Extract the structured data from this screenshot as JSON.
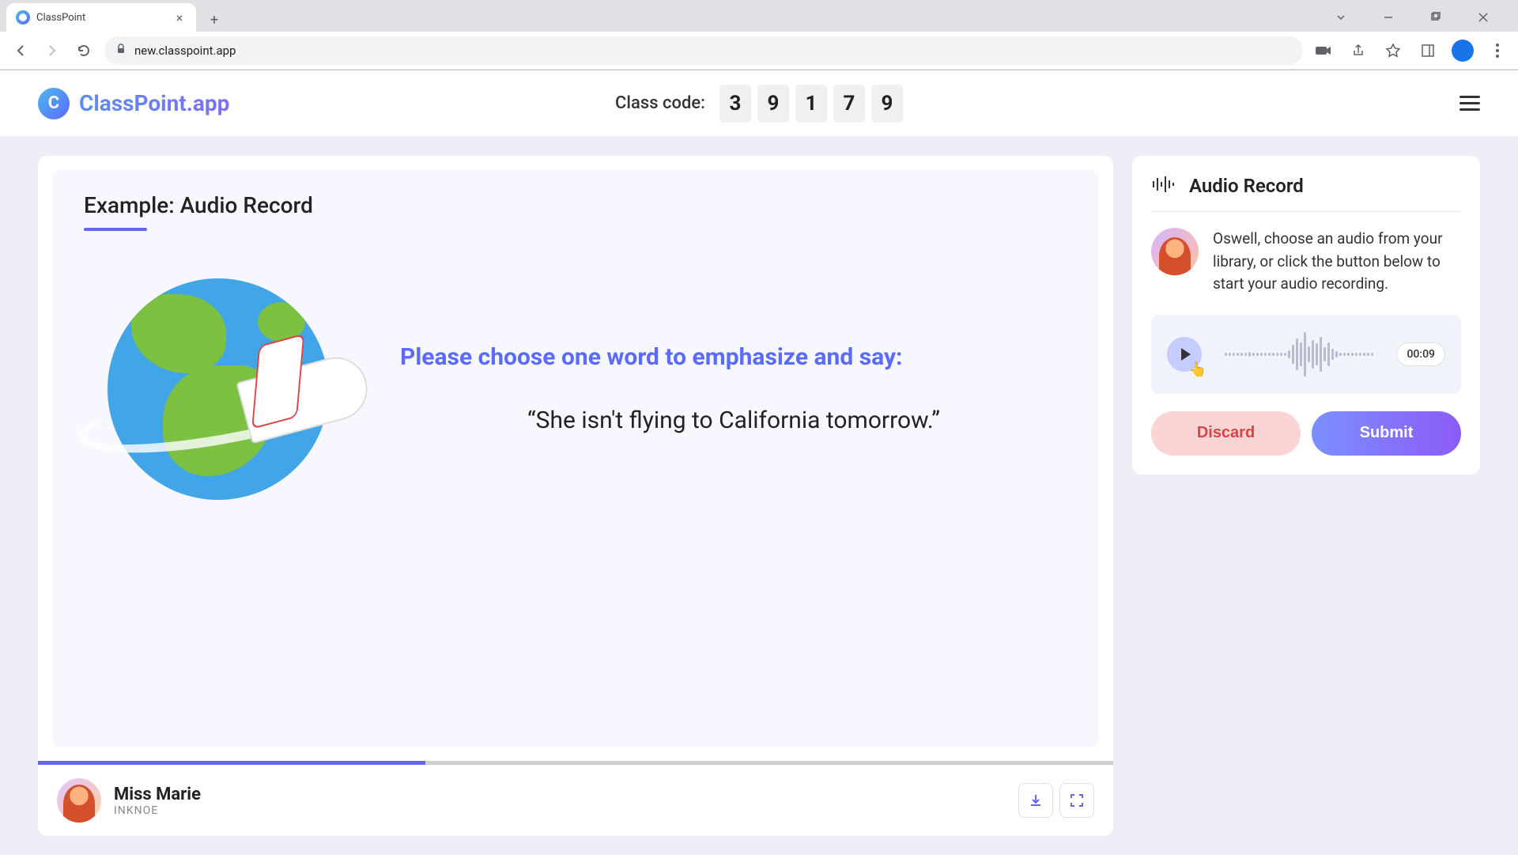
{
  "browser": {
    "tab_title": "ClassPoint",
    "url": "new.classpoint.app"
  },
  "header": {
    "logo_text": "ClassPoint.app",
    "class_code_label": "Class code:",
    "code_digits": [
      "3",
      "9",
      "1",
      "7",
      "9"
    ]
  },
  "slide": {
    "title": "Example: Audio Record",
    "prompt": "Please choose one word to emphasize and say:",
    "quote": "“She isn't flying to California tomorrow.”"
  },
  "presenter": {
    "name": "Miss Marie",
    "org": "INKNOE"
  },
  "record": {
    "title": "Audio Record",
    "instruction": "Oswell, choose an audio from your library, or click the button below to start your audio recording.",
    "time": "00:09",
    "discard_label": "Discard",
    "submit_label": "Submit"
  }
}
